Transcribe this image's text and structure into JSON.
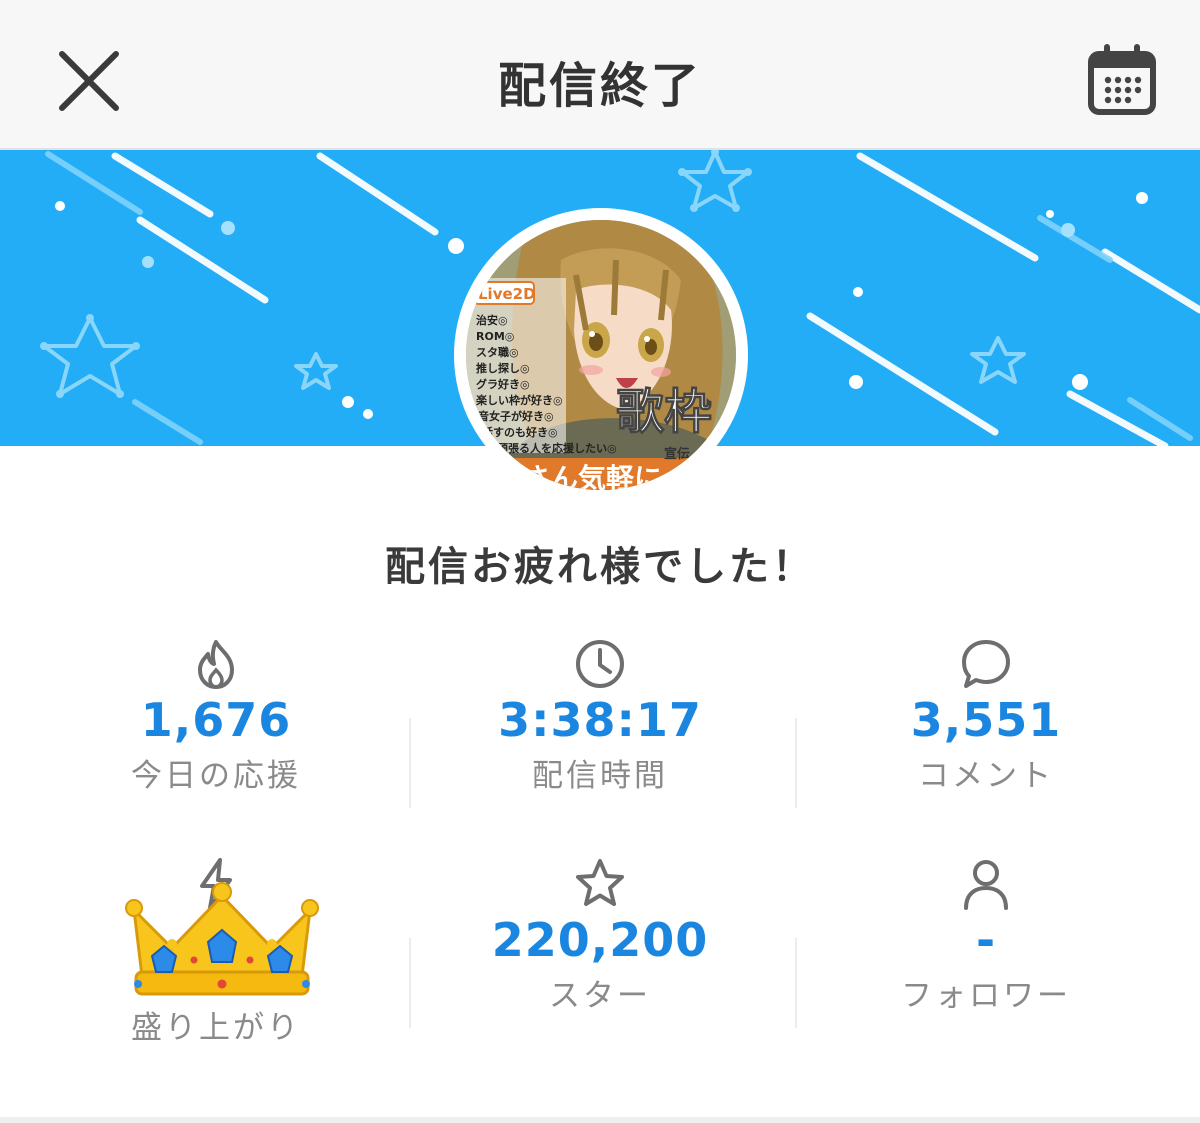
{
  "header": {
    "title": "配信終了",
    "close_icon": "close-icon",
    "calendar_icon": "calendar-icon"
  },
  "banner": {
    "background_color": "#22adf6",
    "avatar_alt": "streamer-avatar",
    "avatar_texts": [
      "Live2D",
      "治安◎",
      "ROM◎",
      "スタ職◎",
      "推し探し◎",
      "グラ好き◎",
      "楽しい枠が好き◎",
      "音女子が好き◎",
      "話すのも好き◎",
      "で頑張る人を応援したい◎",
      "歌枠",
      "宣伝",
      "さん気軽に"
    ]
  },
  "greeting": "配信お疲れ様でした！",
  "stats": [
    {
      "icon": "flame-icon",
      "value": "1,676",
      "label": "今日の応援"
    },
    {
      "icon": "clock-icon",
      "value": "3:38:17",
      "label": "配信時間"
    },
    {
      "icon": "comment-icon",
      "value": "3,551",
      "label": "コメント"
    },
    {
      "icon": "lightning-icon",
      "value": "",
      "label": "盛り上がり"
    },
    {
      "icon": "star-icon",
      "value": "220,200",
      "label": "スター"
    },
    {
      "icon": "person-icon",
      "value": "-",
      "label": "フォロワー"
    }
  ],
  "overlay": {
    "emoji": "crown-emoji"
  },
  "colors": {
    "accent": "#1a86e0",
    "label": "#8a8a8a",
    "icon": "#6e6e6e"
  }
}
